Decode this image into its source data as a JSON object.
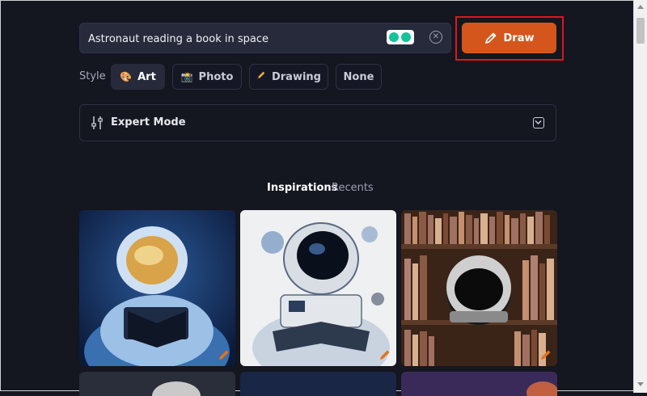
{
  "prompt": {
    "value": "Astronaut reading a book in space",
    "draw_label": "Draw"
  },
  "style": {
    "label": "Style",
    "options": [
      {
        "label": "Art",
        "icon": "palette-icon",
        "active": true
      },
      {
        "label": "Photo",
        "icon": "camera-icon",
        "active": false
      },
      {
        "label": "Drawing",
        "icon": "pencil-icon",
        "active": false
      },
      {
        "label": "None",
        "icon": "",
        "active": false
      }
    ]
  },
  "expert": {
    "label": "Expert Mode"
  },
  "tabs": {
    "inspirations": "Inspirations",
    "recents": "Recents"
  },
  "colors": {
    "accent": "#d4561c",
    "highlight": "#e0151f",
    "background": "#141620",
    "panel": "#262a3b"
  }
}
